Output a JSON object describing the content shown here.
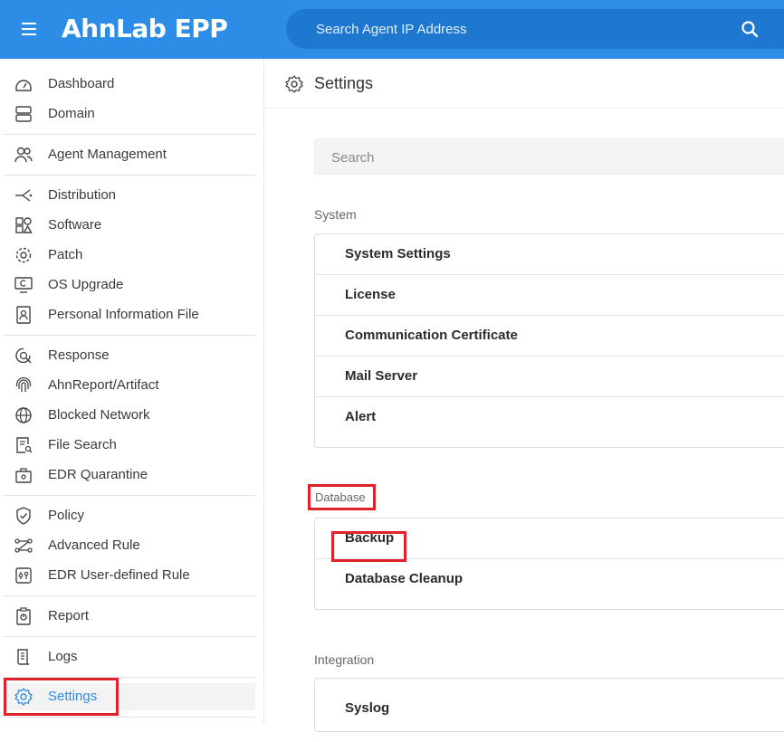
{
  "app": {
    "brand": "AhnLab EPP",
    "top_search_placeholder": "Search Agent IP Address"
  },
  "sidebar": {
    "items": [
      {
        "label": "Dashboard",
        "icon": "dashboard-icon"
      },
      {
        "label": "Domain",
        "icon": "domain-icon"
      },
      {
        "label": "Agent Management",
        "icon": "users-icon"
      },
      {
        "label": "Distribution",
        "icon": "distribution-icon"
      },
      {
        "label": "Software",
        "icon": "software-icon"
      },
      {
        "label": "Patch",
        "icon": "patch-icon"
      },
      {
        "label": "OS Upgrade",
        "icon": "os-upgrade-icon"
      },
      {
        "label": "Personal Information File",
        "icon": "personal-file-icon"
      },
      {
        "label": "Response",
        "icon": "response-icon"
      },
      {
        "label": "AhnReport/Artifact",
        "icon": "fingerprint-icon"
      },
      {
        "label": "Blocked Network",
        "icon": "globe-icon"
      },
      {
        "label": "File Search",
        "icon": "file-search-icon"
      },
      {
        "label": "EDR Quarantine",
        "icon": "quarantine-icon"
      },
      {
        "label": "Policy",
        "icon": "shield-icon"
      },
      {
        "label": "Advanced Rule",
        "icon": "advanced-rule-icon"
      },
      {
        "label": "EDR User-defined Rule",
        "icon": "rule-icon"
      },
      {
        "label": "Report",
        "icon": "report-icon"
      },
      {
        "label": "Logs",
        "icon": "logs-icon"
      },
      {
        "label": "Settings",
        "icon": "gear-icon"
      }
    ],
    "active": "Settings"
  },
  "main": {
    "title": "Settings",
    "search_placeholder": "Search",
    "sections": [
      {
        "label": "System",
        "items": [
          "System Settings",
          "License",
          "Communication Certificate",
          "Mail Server",
          "Alert"
        ]
      },
      {
        "label": "Database",
        "items": [
          "Backup",
          "Database Cleanup"
        ]
      },
      {
        "label": "Integration",
        "items": [
          "Syslog"
        ]
      }
    ]
  },
  "colors": {
    "accent": "#2d8ce6",
    "highlight": "#e0202a"
  }
}
